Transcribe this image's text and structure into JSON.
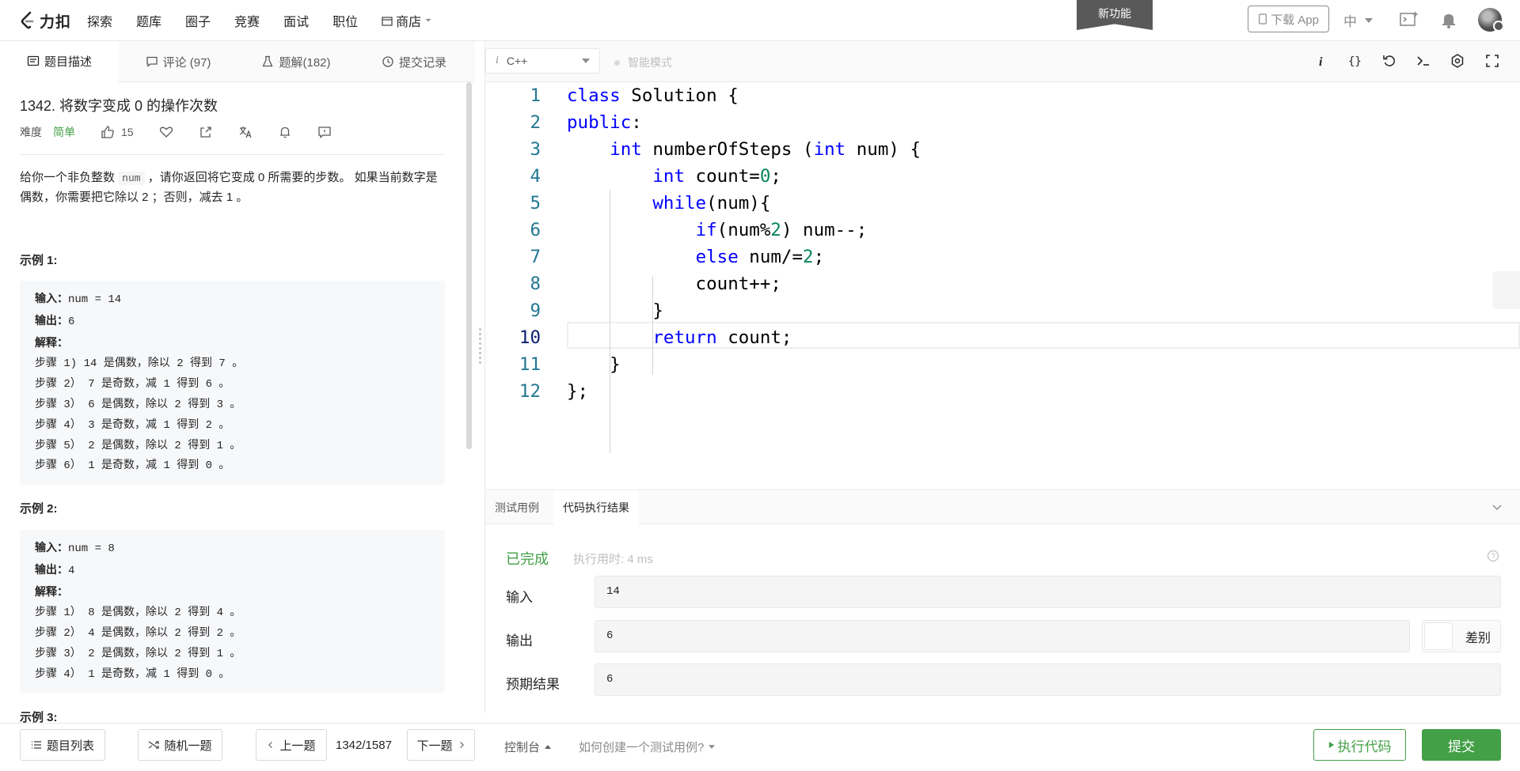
{
  "nav": {
    "logo_text": "力扣",
    "items": [
      "探索",
      "题库",
      "圈子",
      "竞赛",
      "面试",
      "职位"
    ],
    "store": "商店",
    "new_feature": "新功能",
    "download_app": "下载 App",
    "lang": "中"
  },
  "left_tabs": [
    {
      "label": "题目描述",
      "icon": "description-icon"
    },
    {
      "label": "评论 (97)",
      "icon": "comment-icon"
    },
    {
      "label": "题解(182)",
      "icon": "flask-icon"
    },
    {
      "label": "提交记录",
      "icon": "history-icon"
    }
  ],
  "problem": {
    "title": "1342. 将数字变成 0 的操作次数",
    "difficulty_label": "难度",
    "difficulty": "简单",
    "likes": "15",
    "desc_part1": "给你一个非负整数 ",
    "desc_code": "num",
    "desc_part2": " ，请你返回将它变成 0 所需要的步数。 如果当前数字是偶数，你需要把它除以 2 ；否则，减去 1 。",
    "examples": [
      {
        "title": "示例 1:",
        "input_label": "输入：",
        "input": "num = 14",
        "output_label": "输出：",
        "output": "6",
        "explain_label": "解释：",
        "steps": [
          "步骤 1) 14 是偶数，除以 2 得到 7 。",
          "步骤 2） 7 是奇数，减 1 得到 6 。",
          "步骤 3） 6 是偶数，除以 2 得到 3 。",
          "步骤 4） 3 是奇数，减 1 得到 2 。",
          "步骤 5） 2 是偶数，除以 2 得到 1 。",
          "步骤 6） 1 是奇数，减 1 得到 0 。"
        ]
      },
      {
        "title": "示例 2:",
        "input_label": "输入：",
        "input": "num = 8",
        "output_label": "输出：",
        "output": "4",
        "explain_label": "解释：",
        "steps": [
          "步骤 1） 8 是偶数，除以 2 得到 4 。",
          "步骤 2） 4 是偶数，除以 2 得到 2 。",
          "步骤 3） 2 是偶数，除以 2 得到 1 。",
          "步骤 4） 1 是奇数，减 1 得到 0 。"
        ]
      }
    ],
    "example3_title": "示例 3:"
  },
  "editor": {
    "language": "C++",
    "lang_icon": "i",
    "smart_mode": "智能模式",
    "active_line": 10,
    "lines": [
      {
        "n": "1",
        "tokens": [
          [
            "kw",
            "class"
          ],
          [
            "",
            " Solution {"
          ]
        ]
      },
      {
        "n": "2",
        "tokens": [
          [
            "kw",
            "public"
          ],
          [
            "",
            ":"
          ]
        ]
      },
      {
        "n": "3",
        "tokens": [
          [
            "",
            "    "
          ],
          [
            "kw",
            "int"
          ],
          [
            "",
            " numberOfSteps ("
          ],
          [
            "kw",
            "int"
          ],
          [
            "",
            " num) {"
          ]
        ]
      },
      {
        "n": "4",
        "tokens": [
          [
            "",
            "        "
          ],
          [
            "kw",
            "int"
          ],
          [
            "",
            " count="
          ],
          [
            "num",
            "0"
          ],
          [
            "",
            ";"
          ]
        ]
      },
      {
        "n": "5",
        "tokens": [
          [
            "",
            "        "
          ],
          [
            "kw",
            "while"
          ],
          [
            "",
            "(num){"
          ]
        ]
      },
      {
        "n": "6",
        "tokens": [
          [
            "",
            "            "
          ],
          [
            "kw",
            "if"
          ],
          [
            "",
            "(num%"
          ],
          [
            "num",
            "2"
          ],
          [
            "",
            ") num--;"
          ]
        ]
      },
      {
        "n": "7",
        "tokens": [
          [
            "",
            "            "
          ],
          [
            "kw",
            "else"
          ],
          [
            "",
            " num/="
          ],
          [
            "num",
            "2"
          ],
          [
            "",
            ";"
          ]
        ]
      },
      {
        "n": "8",
        "tokens": [
          [
            "",
            "            count++;"
          ]
        ]
      },
      {
        "n": "9",
        "tokens": [
          [
            "",
            "        }"
          ]
        ]
      },
      {
        "n": "10",
        "tokens": [
          [
            "",
            "        "
          ],
          [
            "kw",
            "return"
          ],
          [
            "",
            " count;"
          ]
        ]
      },
      {
        "n": "11",
        "tokens": [
          [
            "",
            "    }"
          ]
        ]
      },
      {
        "n": "12",
        "tokens": [
          [
            "",
            "};"
          ]
        ]
      }
    ]
  },
  "result": {
    "tab_testcase": "测试用例",
    "tab_result": "代码执行结果",
    "status": "已完成",
    "runtime": "执行用时: 4 ms",
    "input_label": "输入",
    "input": "14",
    "output_label": "输出",
    "output": "6",
    "diff_label": "差别",
    "expected_label": "预期结果",
    "expected": "6"
  },
  "bottom": {
    "problem_list": "题目列表",
    "random": "随机一题",
    "prev": "上一题",
    "counter": "1342/1587",
    "next": "下一题",
    "console": "控制台",
    "howto": "如何创建一个测试用例?",
    "run": "执行代码",
    "submit": "提交"
  },
  "colors": {
    "accent_green": "#43a047",
    "keyword": "#0000ff",
    "number": "#098658",
    "line_number": "#237893"
  }
}
